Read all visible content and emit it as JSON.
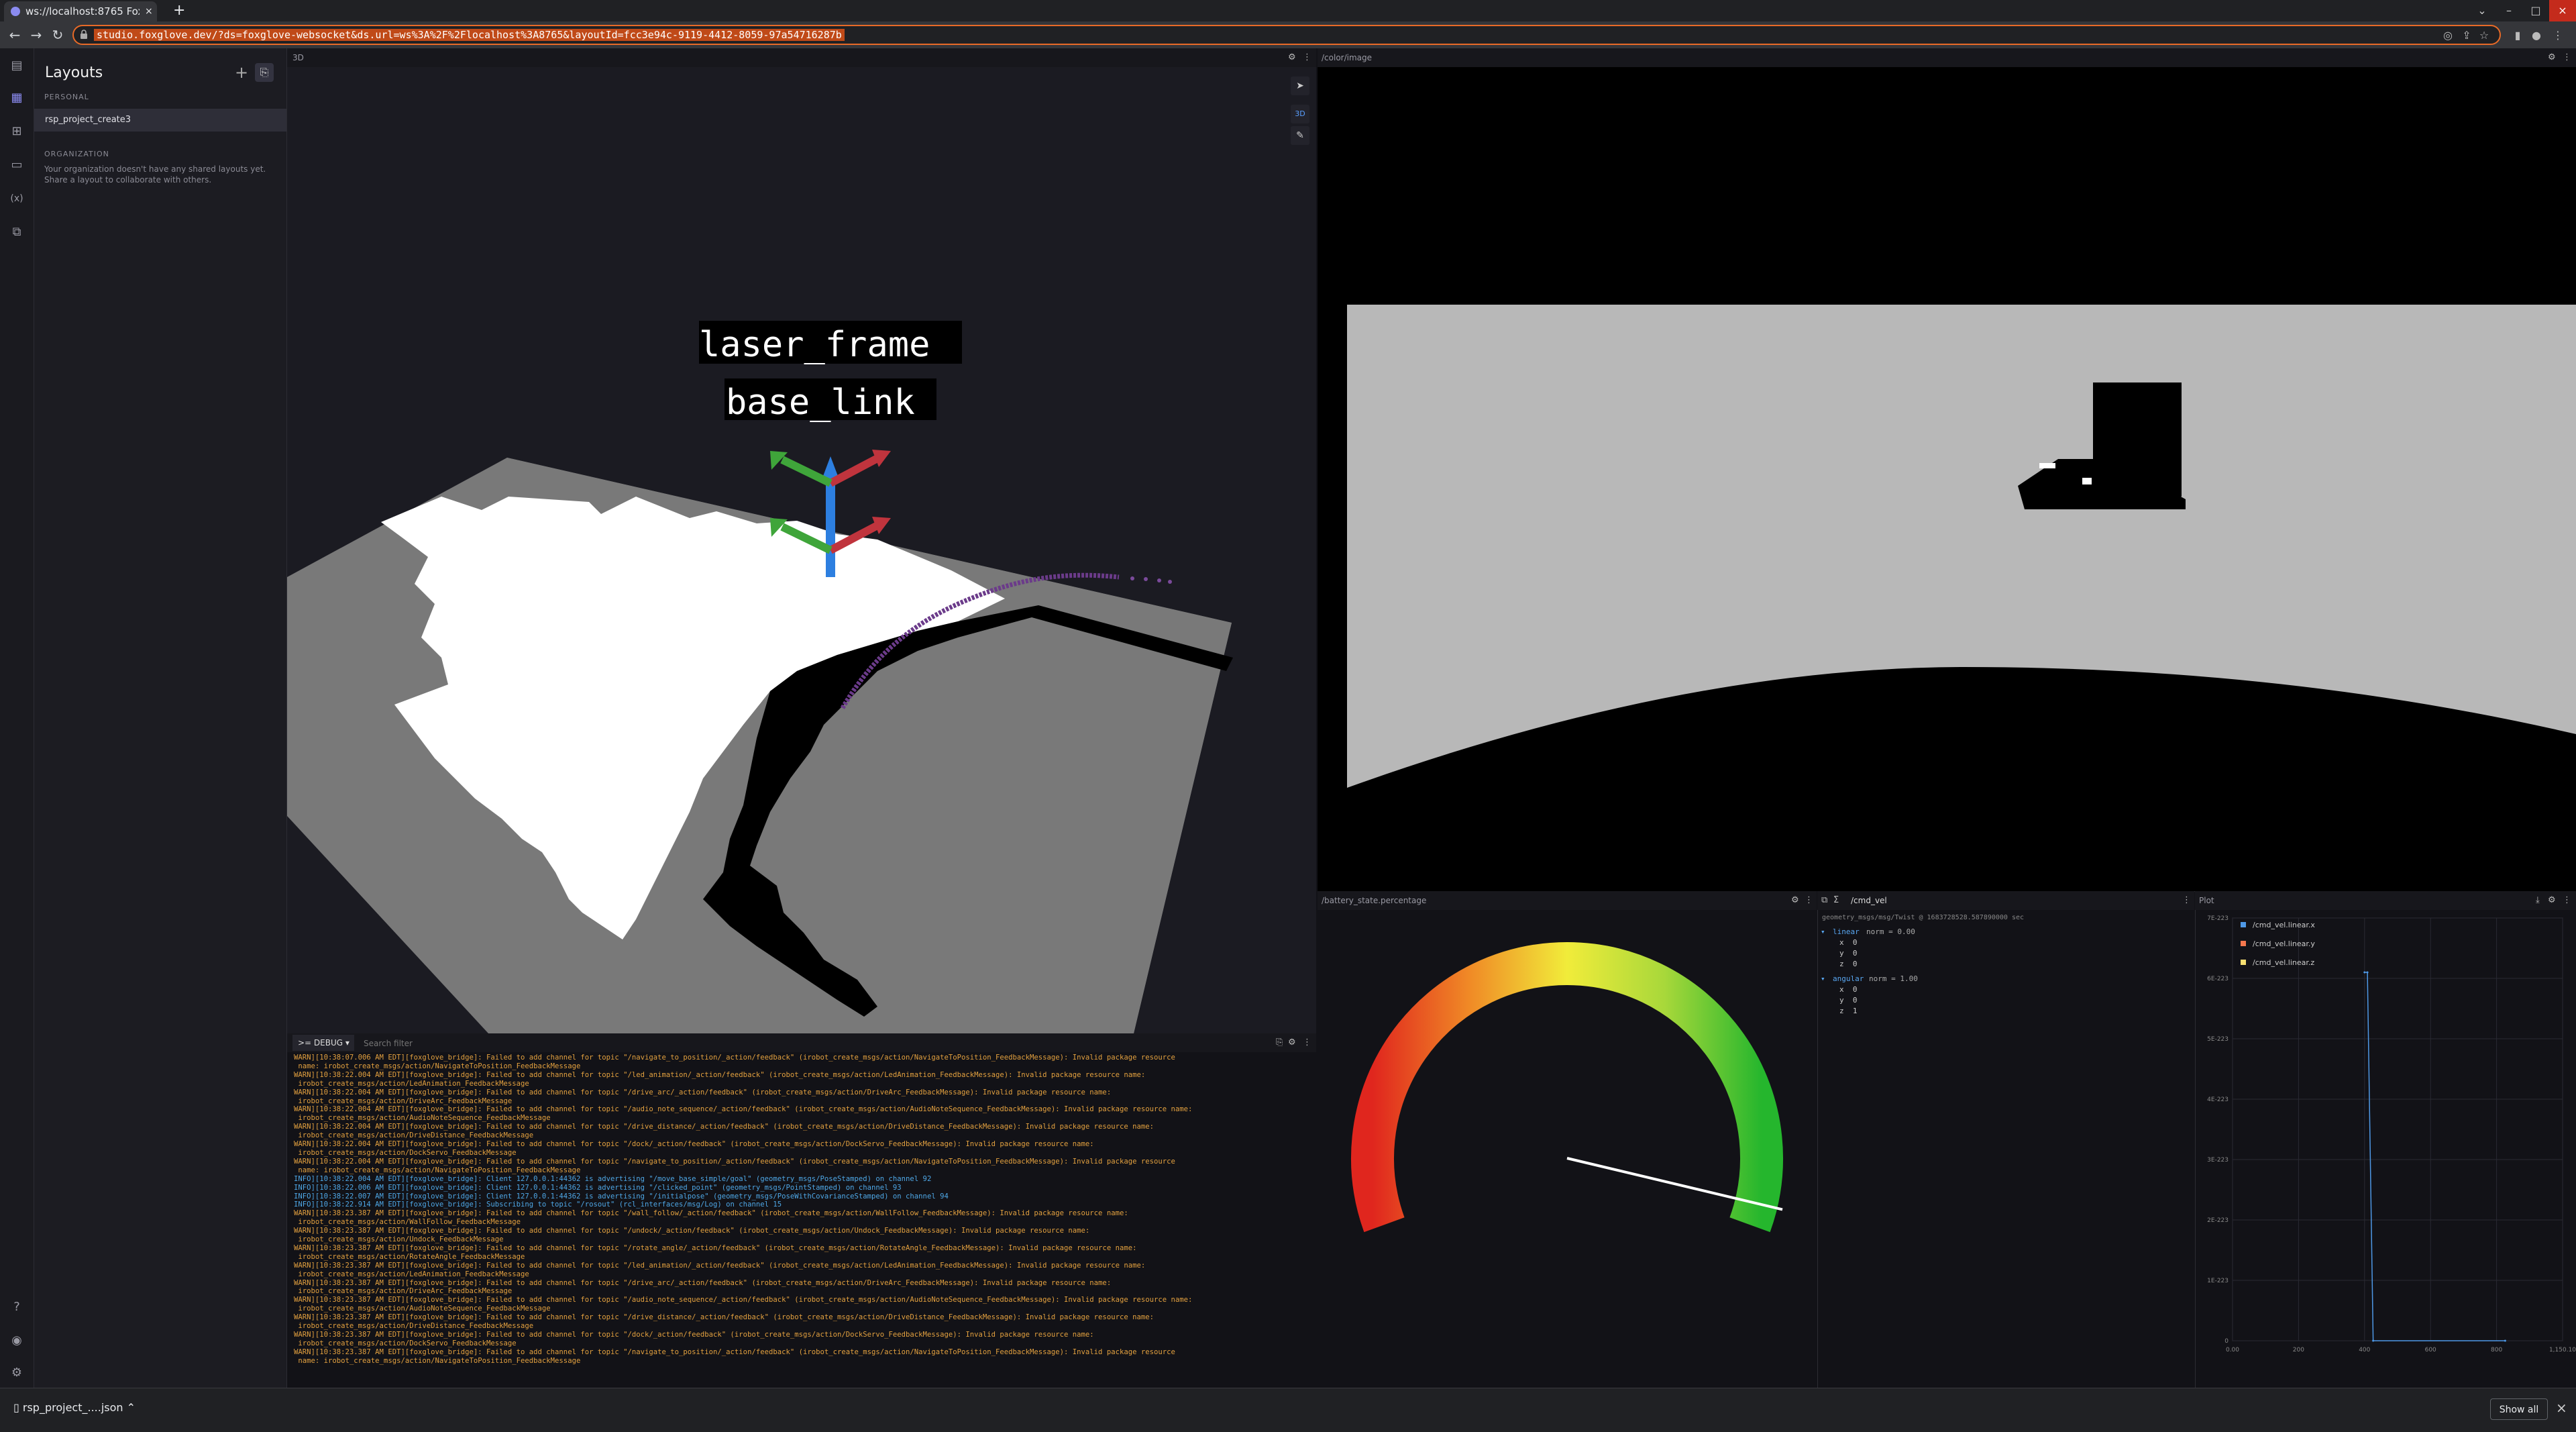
{
  "browser": {
    "tab_title": "ws://localhost:8765 Foxglo",
    "tab_close": "×",
    "new_tab": "+",
    "url": "studio.foxglove.dev/?ds=foxglove-websocket&ds.url=ws%3A%2F%2Flocalhost%3A8765&layoutId=fcc3e94c-9119-4412-8059-97a54716287b",
    "back": "←",
    "forward": "→",
    "reload": "↻",
    "minimize": "–",
    "maximize": "□",
    "close": "×",
    "chevron": "⌄"
  },
  "sidebar": {
    "title": "Layouts",
    "add": "+",
    "personal_label": "PERSONAL",
    "layouts": [
      "rsp_project_create3"
    ],
    "org_label": "ORGANIZATION",
    "org_note": "Your organization doesn't have any shared layouts yet. Share a layout to collaborate with others."
  },
  "panels": {
    "scene": {
      "title": "3D",
      "frame_label_1": "laser_frame",
      "frame_label_2": "base_link"
    },
    "image": {
      "title": "/color/image"
    },
    "log": {
      "level": ">= DEBUG",
      "filter_placeholder": "Search filter",
      "lines": [
        {
          "level": "warn",
          "text": "WARN][10:38:07.006 AM EDT][foxglove_bridge]: Failed to add channel for topic \"/navigate_to_position/_action/feedback\" (irobot_create_msgs/action/NavigateToPosition_FeedbackMessage): Invalid package resource"
        },
        {
          "level": "warn",
          "text": " name: irobot_create_msgs/action/NavigateToPosition_FeedbackMessage"
        },
        {
          "level": "warn",
          "text": "WARN][10:38:22.004 AM EDT][foxglove_bridge]: Failed to add channel for topic \"/led_animation/_action/feedback\" (irobot_create_msgs/action/LedAnimation_FeedbackMessage): Invalid package resource name:"
        },
        {
          "level": "warn",
          "text": " irobot_create_msgs/action/LedAnimation_FeedbackMessage"
        },
        {
          "level": "warn",
          "text": "WARN][10:38:22.004 AM EDT][foxglove_bridge]: Failed to add channel for topic \"/drive_arc/_action/feedback\" (irobot_create_msgs/action/DriveArc_FeedbackMessage): Invalid package resource name:"
        },
        {
          "level": "warn",
          "text": " irobot_create_msgs/action/DriveArc_FeedbackMessage"
        },
        {
          "level": "warn",
          "text": "WARN][10:38:22.004 AM EDT][foxglove_bridge]: Failed to add channel for topic \"/audio_note_sequence/_action/feedback\" (irobot_create_msgs/action/AudioNoteSequence_FeedbackMessage): Invalid package resource name:"
        },
        {
          "level": "warn",
          "text": " irobot_create_msgs/action/AudioNoteSequence_FeedbackMessage"
        },
        {
          "level": "warn",
          "text": "WARN][10:38:22.004 AM EDT][foxglove_bridge]: Failed to add channel for topic \"/drive_distance/_action/feedback\" (irobot_create_msgs/action/DriveDistance_FeedbackMessage): Invalid package resource name:"
        },
        {
          "level": "warn",
          "text": " irobot_create_msgs/action/DriveDistance_FeedbackMessage"
        },
        {
          "level": "warn",
          "text": "WARN][10:38:22.004 AM EDT][foxglove_bridge]: Failed to add channel for topic \"/dock/_action/feedback\" (irobot_create_msgs/action/DockServo_FeedbackMessage): Invalid package resource name:"
        },
        {
          "level": "warn",
          "text": " irobot_create_msgs/action/DockServo_FeedbackMessage"
        },
        {
          "level": "warn",
          "text": "WARN][10:38:22.004 AM EDT][foxglove_bridge]: Failed to add channel for topic \"/navigate_to_position/_action/feedback\" (irobot_create_msgs/action/NavigateToPosition_FeedbackMessage): Invalid package resource"
        },
        {
          "level": "warn",
          "text": " name: irobot_create_msgs/action/NavigateToPosition_FeedbackMessage"
        },
        {
          "level": "info",
          "text": "INFO][10:38:22.004 AM EDT][foxglove_bridge]: Client 127.0.0.1:44362 is advertising \"/move_base_simple/goal\" (geometry_msgs/PoseStamped) on channel 92"
        },
        {
          "level": "info",
          "text": "INFO][10:38:22.006 AM EDT][foxglove_bridge]: Client 127.0.0.1:44362 is advertising \"/clicked_point\" (geometry_msgs/PointStamped) on channel 93"
        },
        {
          "level": "info",
          "text": "INFO][10:38:22.007 AM EDT][foxglove_bridge]: Client 127.0.0.1:44362 is advertising \"/initialpose\" (geometry_msgs/PoseWithCovarianceStamped) on channel 94"
        },
        {
          "level": "info",
          "text": "INFO][10:38:22.914 AM EDT][foxglove_bridge]: Subscribing to topic \"/rosout\" (rcl_interfaces/msg/Log) on channel 15"
        },
        {
          "level": "warn",
          "text": "WARN][10:38:23.387 AM EDT][foxglove_bridge]: Failed to add channel for topic \"/wall_follow/_action/feedback\" (irobot_create_msgs/action/WallFollow_FeedbackMessage): Invalid package resource name:"
        },
        {
          "level": "warn",
          "text": " irobot_create_msgs/action/WallFollow_FeedbackMessage"
        },
        {
          "level": "warn",
          "text": "WARN][10:38:23.387 AM EDT][foxglove_bridge]: Failed to add channel for topic \"/undock/_action/feedback\" (irobot_create_msgs/action/Undock_FeedbackMessage): Invalid package resource name:"
        },
        {
          "level": "warn",
          "text": " irobot_create_msgs/action/Undock_FeedbackMessage"
        },
        {
          "level": "warn",
          "text": "WARN][10:38:23.387 AM EDT][foxglove_bridge]: Failed to add channel for topic \"/rotate_angle/_action/feedback\" (irobot_create_msgs/action/RotateAngle_FeedbackMessage): Invalid package resource name:"
        },
        {
          "level": "warn",
          "text": " irobot_create_msgs/action/RotateAngle_FeedbackMessage"
        },
        {
          "level": "warn",
          "text": "WARN][10:38:23.387 AM EDT][foxglove_bridge]: Failed to add channel for topic \"/led_animation/_action/feedback\" (irobot_create_msgs/action/LedAnimation_FeedbackMessage): Invalid package resource name:"
        },
        {
          "level": "warn",
          "text": " irobot_create_msgs/action/LedAnimation_FeedbackMessage"
        },
        {
          "level": "warn",
          "text": "WARN][10:38:23.387 AM EDT][foxglove_bridge]: Failed to add channel for topic \"/drive_arc/_action/feedback\" (irobot_create_msgs/action/DriveArc_FeedbackMessage): Invalid package resource name:"
        },
        {
          "level": "warn",
          "text": " irobot_create_msgs/action/DriveArc_FeedbackMessage"
        },
        {
          "level": "warn",
          "text": "WARN][10:38:23.387 AM EDT][foxglove_bridge]: Failed to add channel for topic \"/audio_note_sequence/_action/feedback\" (irobot_create_msgs/action/AudioNoteSequence_FeedbackMessage): Invalid package resource name:"
        },
        {
          "level": "warn",
          "text": " irobot_create_msgs/action/AudioNoteSequence_FeedbackMessage"
        },
        {
          "level": "warn",
          "text": "WARN][10:38:23.387 AM EDT][foxglove_bridge]: Failed to add channel for topic \"/drive_distance/_action/feedback\" (irobot_create_msgs/action/DriveDistance_FeedbackMessage): Invalid package resource name:"
        },
        {
          "level": "warn",
          "text": " irobot_create_msgs/action/DriveDistance_FeedbackMessage"
        },
        {
          "level": "warn",
          "text": "WARN][10:38:23.387 AM EDT][foxglove_bridge]: Failed to add channel for topic \"/dock/_action/feedback\" (irobot_create_msgs/action/DockServo_FeedbackMessage): Invalid package resource name:"
        },
        {
          "level": "warn",
          "text": " irobot_create_msgs/action/DockServo_FeedbackMessage"
        },
        {
          "level": "warn",
          "text": "WARN][10:38:23.387 AM EDT][foxglove_bridge]: Failed to add channel for topic \"/navigate_to_position/_action/feedback\" (irobot_create_msgs/action/NavigateToPosition_FeedbackMessage): Invalid package resource"
        },
        {
          "level": "warn",
          "text": " name: irobot_create_msgs/action/NavigateToPosition_FeedbackMessage"
        }
      ]
    },
    "gauge": {
      "title": "/battery_state.percentage",
      "min": 0,
      "max": 1,
      "value": 0.97
    },
    "raw": {
      "topic": "/cmd_vel",
      "schema": "geometry_msgs/msg/Twist @ 1683728528.587890000 sec",
      "linear_label": "linear",
      "linear_norm": "norm = 0.00",
      "linear_x": "x  0",
      "linear_y": "y  0",
      "linear_z": "z  0",
      "angular_label": "angular",
      "angular_norm": "norm = 1.00",
      "angular_x": "x  0",
      "angular_y": "y  0",
      "angular_z": "z  1"
    },
    "plot": {
      "title": "Plot",
      "legend": [
        {
          "name": "/cmd_vel.linear.x",
          "color": "#4e98e6"
        },
        {
          "name": "/cmd_vel.linear.y",
          "color": "#f5774d"
        },
        {
          "name": "/cmd_vel.linear.z",
          "color": "#f7df71"
        }
      ],
      "y_ticks": [
        "7E-223",
        "6E-223",
        "5E-223",
        "4E-223",
        "3E-223",
        "2E-223",
        "1E-223",
        "0"
      ],
      "x_ticks": [
        "0.00",
        "200",
        "400",
        "600",
        "800",
        "1,150.10"
      ]
    }
  },
  "chart_data": {
    "type": "line",
    "title": "Plot",
    "series": [
      {
        "name": "/cmd_vel.linear.x",
        "x": [
          460,
          470,
          490,
          950
        ],
        "y": [
          6.1e-223,
          6.1e-223,
          0,
          0
        ]
      }
    ],
    "xlim": [
      0,
      1150.1
    ],
    "ylim": [
      0,
      7e-223
    ],
    "grid": true,
    "legend": "top-left"
  },
  "downloads": {
    "file": "rsp_project_....json",
    "show_all": "Show all",
    "close": "×"
  },
  "colors": {
    "accent": "#e86a27",
    "warn": "#e2a03f",
    "info": "#4ea7e6",
    "gauge_start": "#e0261e",
    "gauge_mid": "#f1ec3a",
    "gauge_end": "#25b62d"
  }
}
